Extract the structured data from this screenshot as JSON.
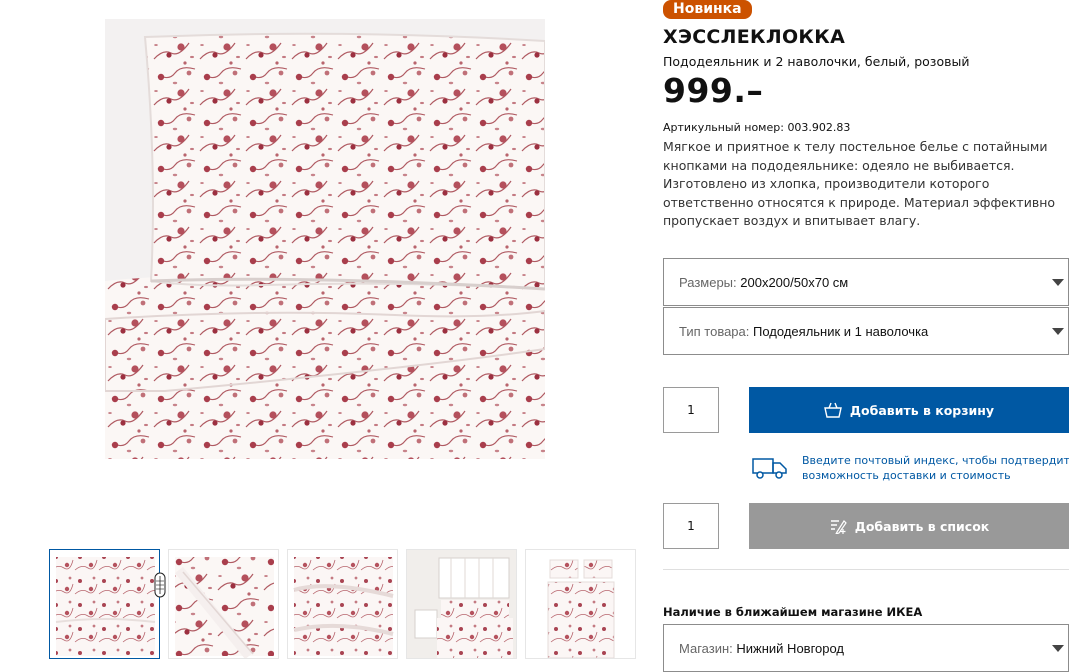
{
  "product": {
    "badge": "Новинка",
    "name": "ХЭССЛЕКЛОККА",
    "subtitle": "Пододеяльник и 2 наволочки, белый, розовый",
    "price": "999.–",
    "article_label": "Артикульный номер:",
    "article_number": "003.902.83",
    "description": "Мягкое и приятное к телу постельное белье с потайными кнопками на пододеяльнике: одеяло не выбивается. Изготовлено из хлопка, производители которого ответственно относятся к природе. Материал эффективно пропускает воздух и впитывает влагу."
  },
  "options": {
    "size": {
      "label": "Размеры:",
      "value": "200x200/50x70 см"
    },
    "type": {
      "label": "Тип товара:",
      "value": "Пододеяльник и 1 наволочка"
    }
  },
  "purchase": {
    "quantity": "1",
    "add_to_cart": "Добавить в корзину",
    "delivery_text_1": "Введите почтовый индекс, чтобы подтвердить",
    "delivery_text_2": "возможность доставки и стоимость"
  },
  "wishlist": {
    "quantity": "1",
    "add_to_list": "Добавить в список"
  },
  "stock": {
    "title": "Наличие в ближайшем магазине ИКЕА",
    "store_label": "Магазин:",
    "store_value": "Нижний Новгород"
  },
  "colors": {
    "brand_blue": "#0058a3",
    "badge_orange": "#cc5200",
    "disabled_gray": "#999999",
    "floral_red": "#b04a55"
  },
  "icons": [
    "bag-icon",
    "truck-icon",
    "list-add-icon",
    "caret-down-icon",
    "zoom-cursor-icon"
  ]
}
